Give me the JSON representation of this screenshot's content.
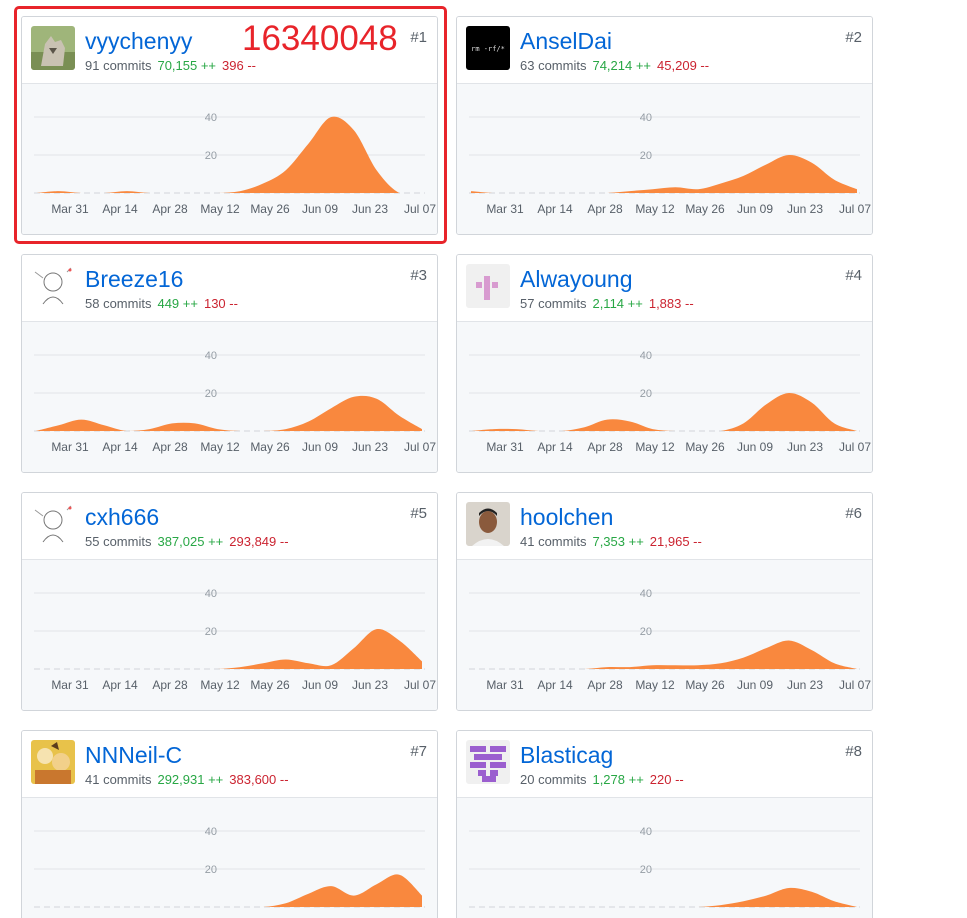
{
  "contributors": [
    {
      "rank": "#1",
      "username": "vyychenyy",
      "commits_label": "91 commits",
      "additions": "70,155 ++",
      "deletions": "396 --",
      "avatar_icon": "wolf-photo-avatar",
      "activity": [
        0,
        1,
        0,
        0,
        1,
        0,
        0,
        0,
        0,
        1,
        5,
        12,
        26,
        40,
        33,
        12,
        0,
        0
      ],
      "peak_week_commits": 40
    },
    {
      "rank": "#2",
      "username": "AnselDai",
      "commits_label": "63 commits",
      "additions": "74,214 ++",
      "deletions": "45,209 --",
      "avatar_icon": "terminal-avatar",
      "avatar_text": "rm -rf/*",
      "activity": [
        1,
        0,
        0,
        0,
        0,
        0,
        0,
        1,
        2,
        3,
        2,
        5,
        9,
        15,
        20,
        16,
        7,
        2
      ],
      "peak_week_commits": 21
    },
    {
      "rank": "#3",
      "username": "Breeze16",
      "commits_label": "58 commits",
      "additions": "449 ++",
      "deletions": "130 --",
      "avatar_icon": "sketch-girl-avatar",
      "activity": [
        0,
        3,
        6,
        3,
        0,
        1,
        4,
        4,
        1,
        0,
        0,
        1,
        5,
        12,
        18,
        17,
        8,
        1
      ],
      "peak_week_commits": 18
    },
    {
      "rank": "#4",
      "username": "Alwayoung",
      "commits_label": "57 commits",
      "additions": "2,114 ++",
      "deletions": "1,883 --",
      "avatar_icon": "pixel-identicon-pink",
      "activity": [
        0,
        1,
        1,
        0,
        0,
        2,
        6,
        5,
        1,
        0,
        0,
        0,
        4,
        14,
        20,
        15,
        4,
        0
      ],
      "peak_week_commits": 20
    },
    {
      "rank": "#5",
      "username": "cxh666",
      "commits_label": "55 commits",
      "additions": "387,025 ++",
      "deletions": "293,849 --",
      "avatar_icon": "sketch-girl-avatar",
      "activity": [
        0,
        0,
        0,
        0,
        0,
        0,
        0,
        0,
        0,
        1,
        3,
        5,
        3,
        2,
        11,
        21,
        15,
        4
      ],
      "peak_week_commits": 22
    },
    {
      "rank": "#6",
      "username": "hoolchen",
      "commits_label": "41 commits",
      "additions": "7,353 ++",
      "deletions": "21,965 --",
      "avatar_icon": "person-photo-avatar",
      "activity": [
        0,
        0,
        0,
        0,
        0,
        0,
        1,
        1,
        2,
        2,
        2,
        3,
        6,
        11,
        15,
        10,
        3,
        0
      ],
      "peak_week_commits": 15
    },
    {
      "rank": "#7",
      "username": "NNNeil-C",
      "commits_label": "41 commits",
      "additions": "292,931 ++",
      "deletions": "383,600 --",
      "avatar_icon": "anime-avatar",
      "activity": [
        0,
        0,
        0,
        0,
        0,
        0,
        0,
        0,
        0,
        0,
        0,
        2,
        7,
        11,
        6,
        12,
        17,
        6
      ],
      "peak_week_commits": 18
    },
    {
      "rank": "#8",
      "username": "Blasticag",
      "commits_label": "20 commits",
      "additions": "1,278 ++",
      "deletions": "220 --",
      "avatar_icon": "pixel-identicon-purple",
      "activity": [
        0,
        0,
        0,
        0,
        0,
        0,
        0,
        0,
        0,
        0,
        0,
        1,
        3,
        6,
        10,
        8,
        3,
        0
      ],
      "peak_week_commits": 10
    }
  ],
  "axis": {
    "x_ticks": [
      "Mar 31",
      "Apr 14",
      "Apr 28",
      "May 12",
      "May 26",
      "Jun 09",
      "Jun 23",
      "Jul 07"
    ],
    "y_ticks": [
      20,
      40
    ],
    "y_max": 44
  },
  "annotation": {
    "student_id": "16340048"
  },
  "colors": {
    "area_fill": "#f9883e",
    "link": "#0366d6",
    "add": "#28a745",
    "del": "#cb2431",
    "highlight": "#e8242a"
  }
}
